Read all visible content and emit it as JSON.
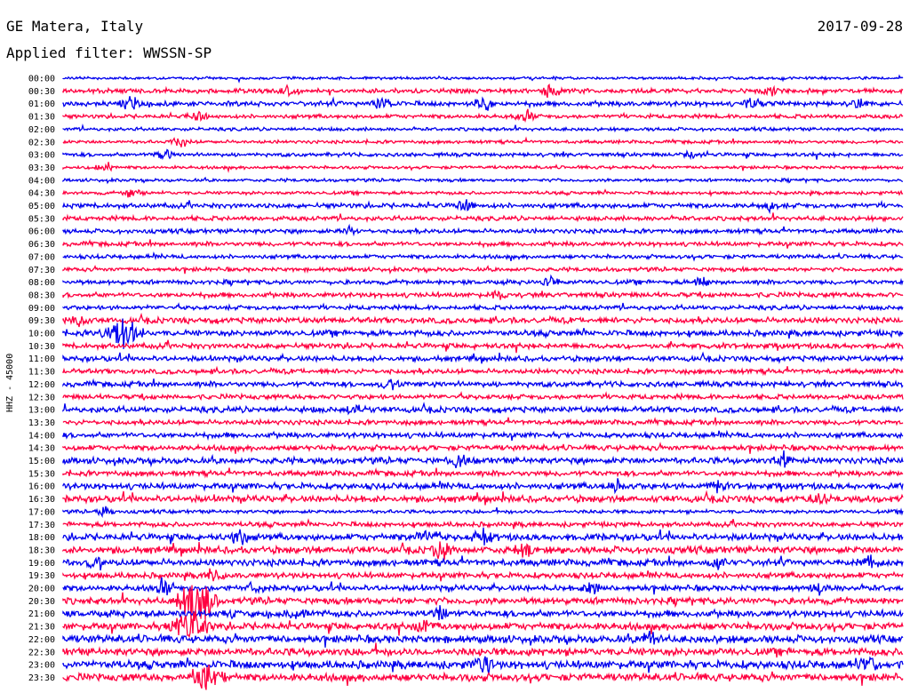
{
  "header": {
    "station": "GE Matera, Italy",
    "date": "2017-09-28",
    "filter": "Applied filter: WWSSN-SP"
  },
  "chart_data": {
    "type": "line",
    "ylabel": "HHZ - 45000",
    "colors": {
      "blue": "#0000ee",
      "red": "#ff0040"
    },
    "rows": [
      {
        "label": "00:00",
        "color": "blue",
        "amp": 1.2,
        "bursts": []
      },
      {
        "label": "00:30",
        "color": "red",
        "amp": 2.0,
        "bursts": [
          [
            0.27,
            6
          ],
          [
            0.58,
            7
          ],
          [
            0.84,
            6
          ]
        ]
      },
      {
        "label": "01:00",
        "color": "blue",
        "amp": 2.2,
        "bursts": [
          [
            0.08,
            7
          ],
          [
            0.38,
            6
          ],
          [
            0.5,
            9
          ],
          [
            0.82,
            7
          ],
          [
            0.95,
            6
          ]
        ]
      },
      {
        "label": "01:30",
        "color": "red",
        "amp": 1.8,
        "bursts": [
          [
            0.16,
            5
          ],
          [
            0.55,
            5
          ]
        ]
      },
      {
        "label": "02:00",
        "color": "blue",
        "amp": 1.5,
        "bursts": []
      },
      {
        "label": "02:30",
        "color": "red",
        "amp": 1.5,
        "bursts": [
          [
            0.14,
            5
          ]
        ]
      },
      {
        "label": "03:00",
        "color": "blue",
        "amp": 1.7,
        "bursts": [
          [
            0.12,
            6
          ],
          [
            0.75,
            5
          ]
        ]
      },
      {
        "label": "03:30",
        "color": "red",
        "amp": 1.4,
        "bursts": [
          [
            0.05,
            8
          ]
        ]
      },
      {
        "label": "04:00",
        "color": "blue",
        "amp": 1.4,
        "bursts": []
      },
      {
        "label": "04:30",
        "color": "red",
        "amp": 1.5,
        "bursts": [
          [
            0.08,
            5
          ]
        ]
      },
      {
        "label": "05:00",
        "color": "blue",
        "amp": 2.2,
        "bursts": [
          [
            0.48,
            6
          ],
          [
            0.84,
            5
          ]
        ]
      },
      {
        "label": "05:30",
        "color": "red",
        "amp": 2.0,
        "bursts": []
      },
      {
        "label": "06:00",
        "color": "blue",
        "amp": 2.0,
        "bursts": [
          [
            0.34,
            5
          ]
        ]
      },
      {
        "label": "06:30",
        "color": "red",
        "amp": 2.0,
        "bursts": []
      },
      {
        "label": "07:00",
        "color": "blue",
        "amp": 1.8,
        "bursts": []
      },
      {
        "label": "07:30",
        "color": "red",
        "amp": 1.8,
        "bursts": []
      },
      {
        "label": "08:00",
        "color": "blue",
        "amp": 2.0,
        "bursts": [
          [
            0.58,
            7
          ],
          [
            0.76,
            6
          ]
        ]
      },
      {
        "label": "08:30",
        "color": "red",
        "amp": 2.2,
        "bursts": [
          [
            0.52,
            5
          ]
        ]
      },
      {
        "label": "09:00",
        "color": "blue",
        "amp": 2.0,
        "bursts": []
      },
      {
        "label": "09:30",
        "color": "red",
        "amp": 2.6,
        "bursts": [
          [
            0.02,
            6
          ]
        ]
      },
      {
        "label": "10:00",
        "color": "blue",
        "amp": 2.6,
        "bursts": [
          [
            0.07,
            17
          ]
        ]
      },
      {
        "label": "10:30",
        "color": "red",
        "amp": 2.4,
        "bursts": []
      },
      {
        "label": "11:00",
        "color": "blue",
        "amp": 2.4,
        "bursts": []
      },
      {
        "label": "11:30",
        "color": "red",
        "amp": 2.2,
        "bursts": []
      },
      {
        "label": "12:00",
        "color": "blue",
        "amp": 2.4,
        "bursts": [
          [
            0.39,
            6
          ]
        ]
      },
      {
        "label": "12:30",
        "color": "red",
        "amp": 2.2,
        "bursts": []
      },
      {
        "label": "13:00",
        "color": "blue",
        "amp": 2.6,
        "bursts": [
          [
            0.35,
            6
          ]
        ]
      },
      {
        "label": "13:30",
        "color": "red",
        "amp": 2.2,
        "bursts": []
      },
      {
        "label": "14:00",
        "color": "blue",
        "amp": 2.4,
        "bursts": []
      },
      {
        "label": "14:30",
        "color": "red",
        "amp": 2.4,
        "bursts": []
      },
      {
        "label": "15:00",
        "color": "blue",
        "amp": 2.8,
        "bursts": [
          [
            0.47,
            6
          ],
          [
            0.86,
            6
          ]
        ]
      },
      {
        "label": "15:30",
        "color": "red",
        "amp": 2.4,
        "bursts": []
      },
      {
        "label": "16:00",
        "color": "blue",
        "amp": 2.8,
        "bursts": [
          [
            0.66,
            7
          ],
          [
            0.78,
            6
          ]
        ]
      },
      {
        "label": "16:30",
        "color": "red",
        "amp": 3.0,
        "bursts": [
          [
            0.9,
            6
          ]
        ]
      },
      {
        "label": "17:00",
        "color": "blue",
        "amp": 1.6,
        "bursts": [
          [
            0.05,
            5
          ]
        ]
      },
      {
        "label": "17:30",
        "color": "red",
        "amp": 2.2,
        "bursts": []
      },
      {
        "label": "18:00",
        "color": "blue",
        "amp": 3.0,
        "bursts": [
          [
            0.21,
            8
          ],
          [
            0.43,
            10
          ],
          [
            0.5,
            9
          ]
        ]
      },
      {
        "label": "18:30",
        "color": "red",
        "amp": 3.2,
        "bursts": [
          [
            0.45,
            9
          ],
          [
            0.55,
            7
          ]
        ]
      },
      {
        "label": "19:00",
        "color": "blue",
        "amp": 3.0,
        "bursts": [
          [
            0.04,
            7
          ],
          [
            0.78,
            8
          ],
          [
            0.96,
            8
          ]
        ]
      },
      {
        "label": "19:30",
        "color": "red",
        "amp": 2.6,
        "bursts": [
          [
            0.18,
            8
          ]
        ]
      },
      {
        "label": "20:00",
        "color": "blue",
        "amp": 2.6,
        "bursts": [
          [
            0.12,
            7
          ],
          [
            0.23,
            6
          ],
          [
            0.63,
            6
          ],
          [
            0.9,
            6
          ]
        ]
      },
      {
        "label": "20:30",
        "color": "red",
        "amp": 3.0,
        "bursts": [
          [
            0.16,
            28
          ]
        ]
      },
      {
        "label": "21:00",
        "color": "blue",
        "amp": 3.0,
        "bursts": [
          [
            0.28,
            6
          ],
          [
            0.45,
            6
          ]
        ]
      },
      {
        "label": "21:30",
        "color": "red",
        "amp": 3.2,
        "bursts": [
          [
            0.15,
            18
          ],
          [
            0.43,
            8
          ]
        ]
      },
      {
        "label": "22:00",
        "color": "blue",
        "amp": 3.4,
        "bursts": [
          [
            0.7,
            7
          ]
        ]
      },
      {
        "label": "22:30",
        "color": "red",
        "amp": 3.4,
        "bursts": []
      },
      {
        "label": "23:00",
        "color": "blue",
        "amp": 3.6,
        "bursts": [
          [
            0.5,
            9
          ],
          [
            0.96,
            8
          ]
        ]
      },
      {
        "label": "23:30",
        "color": "red",
        "amp": 3.4,
        "bursts": [
          [
            0.17,
            14
          ]
        ]
      }
    ]
  }
}
